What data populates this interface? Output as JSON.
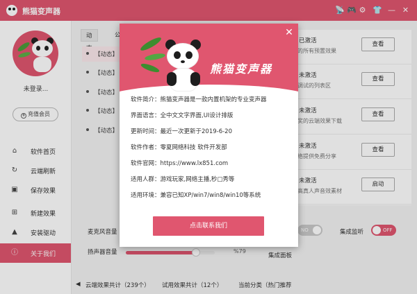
{
  "app": {
    "title": "熊猫变声器",
    "colors": {
      "accent": "#e0566f",
      "bamboo": "#4a9c3a"
    },
    "titlebar_icons": [
      "broadcast-icon",
      "game-icon",
      "settings-icon",
      "skin-icon",
      "minimize-icon",
      "close-icon"
    ],
    "titlebar_glyphs": [
      "📡",
      "🎮",
      "⚙",
      "👕",
      "—",
      "✕"
    ]
  },
  "sidebar": {
    "login_status": "未登录...",
    "recharge_label": "充值会员",
    "recharge_icon": "¥",
    "items": [
      {
        "label": "软件首页",
        "icon": "home-icon",
        "glyph": "⌂"
      },
      {
        "label": "云端刷新",
        "icon": "refresh-icon",
        "glyph": "↻"
      },
      {
        "label": "保存效果",
        "icon": "save-icon",
        "glyph": "▣"
      },
      {
        "label": "新建效果",
        "icon": "new-icon",
        "glyph": "⊞"
      },
      {
        "label": "安装驱动",
        "icon": "driver-icon",
        "glyph": "▲"
      },
      {
        "label": "关于我们",
        "icon": "about-icon",
        "glyph": "ⓘ"
      }
    ]
  },
  "content": {
    "tabs": [
      "动态",
      "公"
    ],
    "feed": [
      "【动态】",
      "【动态】",
      "【动态】",
      "【动态】",
      "【动态】"
    ],
    "list": [
      {
        "title": "已激活",
        "sub": "的所有预置效果",
        "button": "查看"
      },
      {
        "title": "未激活",
        "sub": "调试的列表区",
        "button": "查看"
      },
      {
        "title": "未激活",
        "sub": "奖的云端效果下载",
        "button": "查看"
      },
      {
        "title": "未激活",
        "sub": "络提供免费分享",
        "button": "查看"
      },
      {
        "title": "未激活",
        "sub": "高真人声音效素材",
        "button": "启动"
      }
    ],
    "mic_volume_label": "麦克风音量",
    "speaker_volume_label": "扬声器音量",
    "speaker_volume_value": "%79",
    "speaker_volume": 79,
    "no_toggle_label": "NO",
    "monitor_label": "集成监听",
    "monitor_toggle_label": "OFF",
    "panel_label": "集成面板"
  },
  "statusbar": {
    "cloud_count": "云端效果共计（239个）",
    "trial_count": "试用效果共计（12个）",
    "current_category": "当前分类（热门推荐"
  },
  "modal": {
    "logo_text": "熊猫变声器",
    "lines": [
      "软件简介：熊猫变声器是一款内置机架的专业变声器",
      "界面语言：全中文文字界面,UI设计排版",
      "更新时间：最近一次更新于2019-6-20",
      "软件作者：零夏网络科技 软件开发部",
      "软件官网：https://www.lx851.com",
      "适用人群：游戏玩家,网络主播,秒□秀等",
      "适用环境：兼容已知XP/win7/win8/win10等系统"
    ],
    "contact_button": "点击联系我们"
  }
}
